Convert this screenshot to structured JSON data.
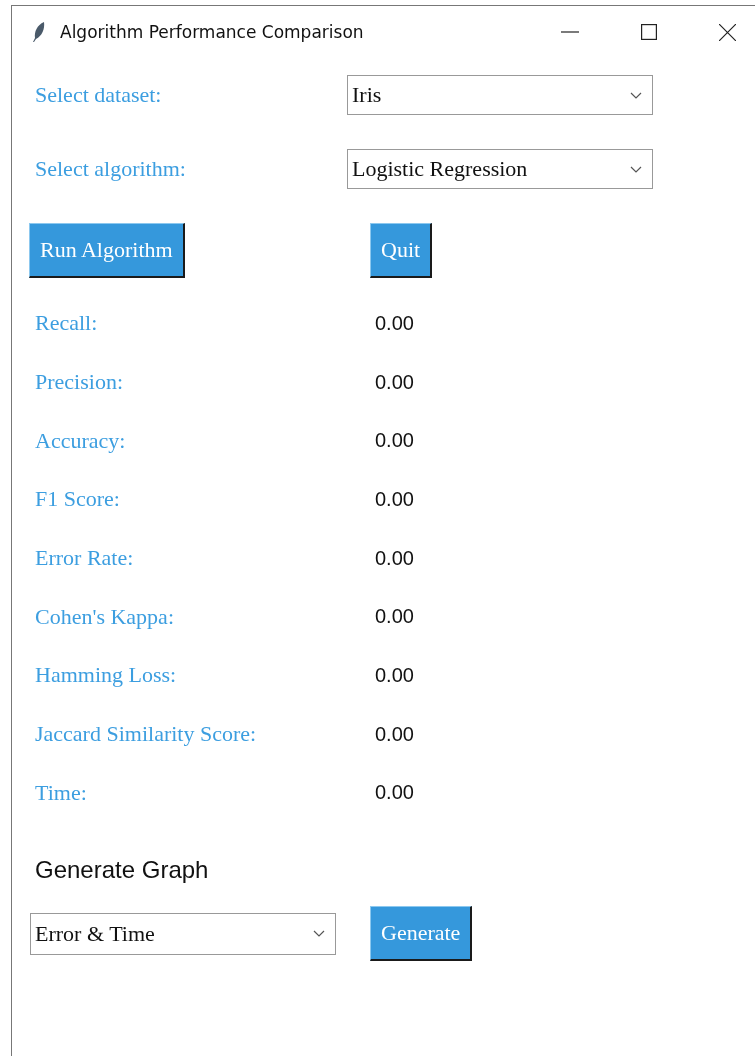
{
  "window": {
    "title": "Algorithm Performance Comparison"
  },
  "selectors": [
    {
      "label": "Select dataset:",
      "value": "Iris"
    },
    {
      "label": "Select algorithm:",
      "value": "Logistic Regression"
    }
  ],
  "buttons": [
    "Run Algorithm",
    "Quit"
  ],
  "metrics": [
    {
      "label": "Recall:",
      "value": "0.00"
    },
    {
      "label": "Precision:",
      "value": "0.00"
    },
    {
      "label": "Accuracy:",
      "value": "0.00"
    },
    {
      "label": "F1 Score:",
      "value": "0.00"
    },
    {
      "label": "Error Rate:",
      "value": "0.00"
    },
    {
      "label": "Cohen's Kappa:",
      "value": "0.00"
    },
    {
      "label": "Hamming Loss:",
      "value": "0.00"
    },
    {
      "label": "Jaccard Similarity Score:",
      "value": "0.00"
    },
    {
      "label": "Time:",
      "value": "0.00"
    }
  ],
  "graph": {
    "heading": "Generate Graph",
    "value": "Error & Time",
    "button": "Generate"
  }
}
